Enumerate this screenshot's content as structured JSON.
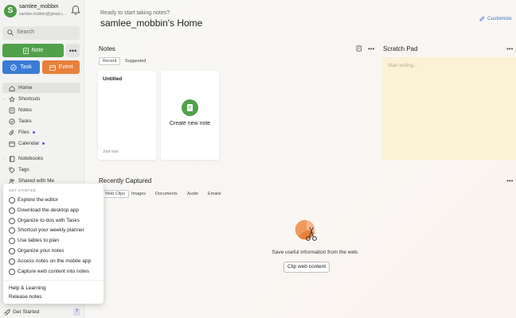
{
  "account": {
    "initial": "S",
    "name": "samlee_mobbin",
    "email": "samlee.mobbin@gmail.c..."
  },
  "search": {
    "placeholder": "Search"
  },
  "actions": {
    "note": "Note",
    "more": "•••",
    "task": "Task",
    "event": "Event"
  },
  "nav": [
    {
      "label": "Home",
      "icon": "home-icon",
      "active": true,
      "caret": false,
      "dot": false
    },
    {
      "label": "Shortcuts",
      "icon": "star-icon",
      "active": false,
      "caret": true,
      "dot": false
    },
    {
      "label": "Notes",
      "icon": "note-icon",
      "active": false,
      "caret": false,
      "dot": false
    },
    {
      "label": "Tasks",
      "icon": "check-circle-icon",
      "active": false,
      "caret": false,
      "dot": false
    },
    {
      "label": "Files",
      "icon": "paperclip-icon",
      "active": false,
      "caret": false,
      "dot": true
    },
    {
      "label": "Calendar",
      "icon": "calendar-icon",
      "active": false,
      "caret": false,
      "dot": true
    },
    {
      "label": "Notebooks",
      "icon": "notebook-icon",
      "active": false,
      "caret": true,
      "dot": false
    },
    {
      "label": "Tags",
      "icon": "tag-icon",
      "active": false,
      "caret": false,
      "dot": false
    },
    {
      "label": "Shared with Me",
      "icon": "people-icon",
      "active": false,
      "caret": false,
      "dot": false
    }
  ],
  "get_started": {
    "header": "GET STARTED",
    "items": [
      "Explore the editor",
      "Download the desktop app",
      "Organize to-dos with Tasks",
      "Shortcut your weekly planner",
      "Use tables to plan",
      "Organize your notes",
      "Access notes on the mobile app",
      "Capture web content into notes"
    ],
    "links": [
      "Help & Learning",
      "Release notes"
    ],
    "footer_label": "Get Started",
    "help_badge": "?"
  },
  "home": {
    "greeting": "Ready to start taking notes?",
    "title": "samlee_mobbin's Home",
    "customize": "Customize"
  },
  "notes_widget": {
    "title": "Notes",
    "tabs": [
      "Recent",
      "Suggested"
    ],
    "card_title": "Untitled",
    "card_date": "Just now",
    "create_label": "Create new note"
  },
  "scratch_pad": {
    "title": "Scratch Pad",
    "placeholder": "Start writing..."
  },
  "recently_captured": {
    "title": "Recently Captured",
    "tabs": [
      "Web Clips",
      "Images",
      "Documents",
      "Audio",
      "Emails"
    ],
    "empty_text": "Save useful information from the web.",
    "button": "Clip web content"
  },
  "colors": {
    "green": "#51a04a",
    "blue": "#3a7bd5",
    "orange": "#e8803a",
    "scratch": "#fbf1d6"
  }
}
